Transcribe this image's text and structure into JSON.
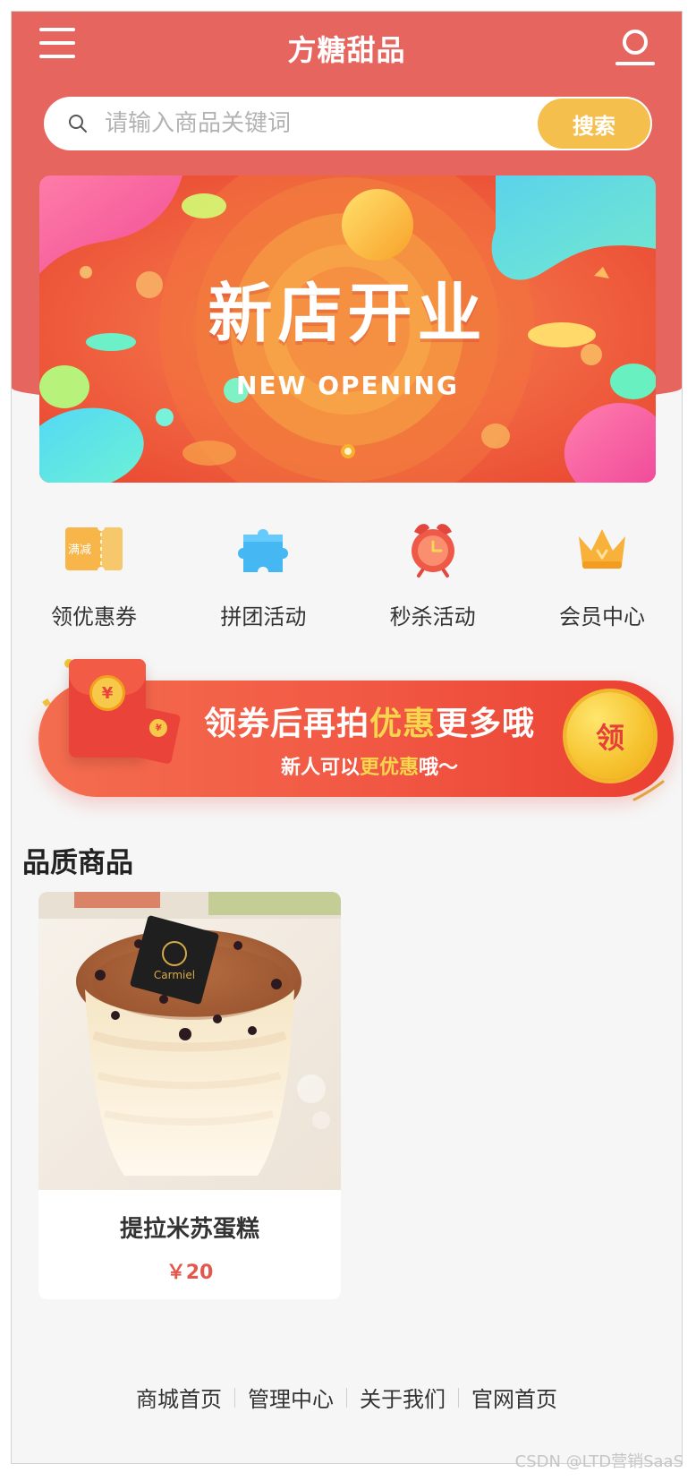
{
  "header": {
    "title": "方糖甜品",
    "menu_icon": "menu-icon",
    "user_icon": "user-icon"
  },
  "search": {
    "placeholder": "请输入商品关键词",
    "button_label": "搜索",
    "icon": "search-icon"
  },
  "banner": {
    "title": "新店开业",
    "subtitle": "NEW OPENING",
    "active_slide": 1,
    "total_slides": 1
  },
  "quick_menu": [
    {
      "label": "领优惠券",
      "icon": "coupon-icon",
      "icon_text": "满减"
    },
    {
      "label": "拼团活动",
      "icon": "puzzle-icon"
    },
    {
      "label": "秒杀活动",
      "icon": "alarm-clock-icon"
    },
    {
      "label": "会员中心",
      "icon": "crown-icon"
    }
  ],
  "coupon_banner": {
    "line1_prefix": "领券后再拍",
    "line1_highlight": "优惠",
    "line1_suffix": "更多哦",
    "line2_prefix": "新人可以",
    "line2_highlight": "更优惠",
    "line2_suffix": "哦～",
    "claim_label": "领",
    "coin_symbol": "¥"
  },
  "section": {
    "title": "品质商品"
  },
  "products": [
    {
      "name": "提拉米苏蛋糕",
      "price": "￥20",
      "image_logo": "Carmiel"
    }
  ],
  "footer": {
    "links": [
      "商城首页",
      "管理中心",
      "关于我们",
      "官网首页"
    ]
  },
  "watermark": "CSDN @LTD营销SaaS",
  "colors": {
    "header_bg": "#e6655f",
    "search_button": "#f4bf4d",
    "price": "#e4574e",
    "coupon_accent": "#f7d54c"
  }
}
